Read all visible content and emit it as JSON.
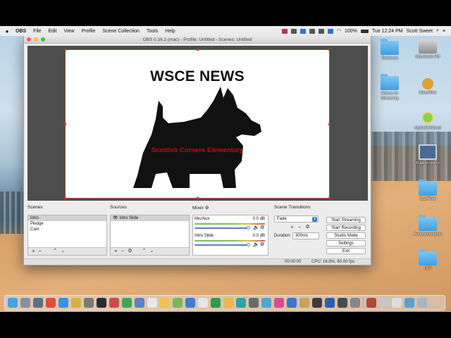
{
  "menubar": {
    "apple": "",
    "items": [
      "OBS",
      "File",
      "Edit",
      "View",
      "Profile",
      "Scene Collection",
      "Tools",
      "Help"
    ],
    "battery": "100%",
    "clock": "Tue 12:24 PM",
    "user": "Scott Sweet"
  },
  "window": {
    "title": "OBS 0.16.2 (mac) - Profile: Untitled - Scenes: Untitled"
  },
  "preview": {
    "headline": "WSCE NEWS",
    "subtitle": "Scottish Corners Elementary"
  },
  "scenes": {
    "label": "Scenes",
    "items": [
      "Intro",
      "Pledge",
      "Cam"
    ],
    "selected": 0
  },
  "sources": {
    "label": "Sources",
    "items": [
      "Intro Slide"
    ]
  },
  "mixer": {
    "label": "Mixer",
    "channels": [
      {
        "name": "Mic/Aux",
        "db": "0.0 dB",
        "level": 0.7
      },
      {
        "name": "Intro Slide",
        "db": "0.0 dB",
        "level": 0.7
      }
    ]
  },
  "transitions": {
    "label": "Scene Transitions",
    "selected": "Fade",
    "duration_label": "Duration",
    "duration_value": "300ms"
  },
  "controls": {
    "start_streaming": "Start Streaming",
    "start_recording": "Start Recording",
    "studio_mode": "Studio Mode",
    "settings": "Settings",
    "exit": "Exit"
  },
  "status": {
    "time": "00:00:00",
    "cpu": "CPU: 16.8%, 60.00 fps"
  },
  "desktop": {
    "icons": [
      "Techtoom",
      "Macintosh HD",
      "Videos for Streaming",
      "ClassFiles",
      "MyDublinCloud",
      "PublicFolders",
      "StaffFiles",
      "Announcements",
      "ITIP"
    ]
  },
  "colors": {
    "accent_red": "#b01515",
    "selection_border": "#c43a3a",
    "folder_blue": "#3f9fe3"
  }
}
